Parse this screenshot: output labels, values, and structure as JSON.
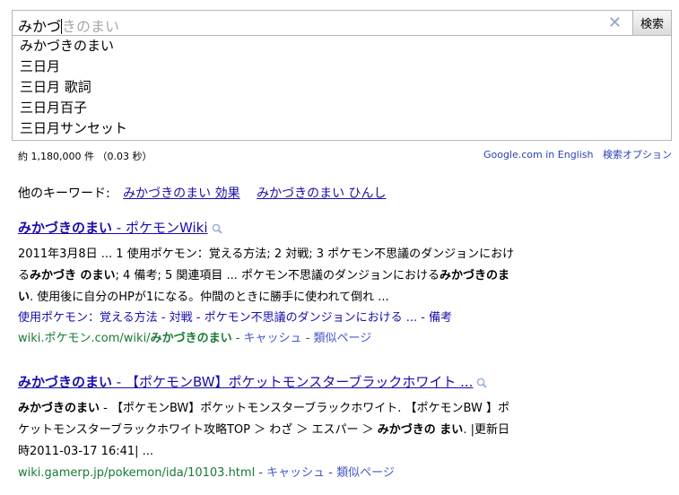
{
  "search": {
    "typed": "みかづ",
    "completion": "きのまい",
    "button_label": "検索",
    "clear_icon": "✕"
  },
  "suggestions": [
    "みかづきのまい",
    "三日月",
    "三日月 歌詞",
    "三日月百子",
    "三日月サンセット"
  ],
  "stats": "約 1,180,000 件 （0.03 秒）",
  "top_links": [
    "Google.com in English",
    "検索オプション"
  ],
  "related": {
    "label": "他のキーワード:",
    "items": [
      "みかづきのまい 効果",
      "みかづきのまい ひんし"
    ]
  },
  "results": [
    {
      "title_bold": "みかづきのまい",
      "title_rest": " - ポケモンWiki",
      "snippet": {
        "l1": "2011年3月8日 ... 1 使用ポケモン：覚える方法; 2 対戦; 3 ポケモン不思議のダンジョンにおけ",
        "l2_a": "る",
        "l2_b": "みかづき のまい",
        "l2_c": "; 4 備考; 5 関連項目 ... ポケモン不思議のダンジョンにおける",
        "l2_d": "みかづきのま",
        "l3_a": "い",
        "l3_b": ". 使用後に自分のHPが1になる。仲間のときに勝手に使われて倒れ ..."
      },
      "sitelinks": [
        "使用ポケモン：覚える方法",
        "対戦",
        "ポケモン不思議のダンジョンにおける ...",
        "備考"
      ],
      "url_a": "wiki.ポケモン.com/wiki/",
      "url_b": "みかづきのまい",
      "cache": "キャッシュ",
      "similar": "類似ページ"
    },
    {
      "title_bold": "みかづきのまい",
      "title_rest": " - 【ポケモンBW】ポケットモンスターブラックホワイト ...",
      "snippet": {
        "l1_a": "みかづきのまい",
        "l1_b": " - 【ポケモンBW】ポケットモンスターブラックホワイト. 【ポケモンBW 】ポ",
        "l2_a": "ケットモンスターブラックホワイト攻略TOP ＞ わざ ＞ エスパー ＞ ",
        "l2_b": "みかづきの まい",
        "l2_c": ". |更新日",
        "l3": "時2011-03-17 16:41| ..."
      },
      "url": "wiki.gamerp.jp/pokemon/ida/10103.html",
      "cache": "キャッシュ",
      "similar": "類似ページ"
    }
  ]
}
